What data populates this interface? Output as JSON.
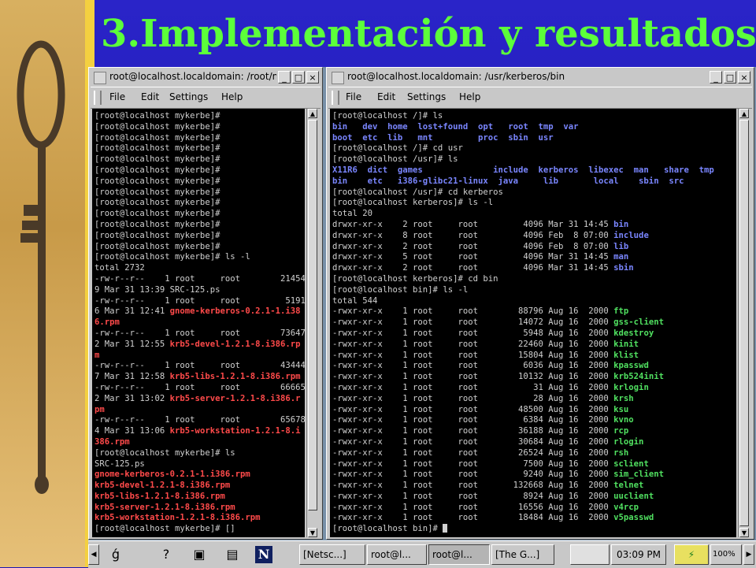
{
  "slide": {
    "title": "3.Implementación y resultados"
  },
  "colors": {
    "title": "#5cff3a",
    "slide_bg": "#1a16b4",
    "term_bg": "#000000",
    "prompt": "#d0d0d0",
    "red": "#ff4a4a",
    "blue": "#7a86ff"
  },
  "left_window": {
    "title": "root@localhost.localdomain: /root/mykerberos",
    "menu": [
      "File",
      "Edit",
      "Settings",
      "Help"
    ],
    "lines": [
      [
        {
          "t": "[root@localhost mykerbe]#"
        }
      ],
      [
        {
          "t": "[root@localhost mykerbe]#"
        }
      ],
      [
        {
          "t": "[root@localhost mykerbe]#"
        }
      ],
      [
        {
          "t": "[root@localhost mykerbe]#"
        }
      ],
      [
        {
          "t": "[root@localhost mykerbe]#"
        }
      ],
      [
        {
          "t": "[root@localhost mykerbe]#"
        }
      ],
      [
        {
          "t": "[root@localhost mykerbe]#"
        }
      ],
      [
        {
          "t": "[root@localhost mykerbe]#"
        }
      ],
      [
        {
          "t": "[root@localhost mykerbe]#"
        }
      ],
      [
        {
          "t": "[root@localhost mykerbe]#"
        }
      ],
      [
        {
          "t": "[root@localhost mykerbe]#"
        }
      ],
      [
        {
          "t": "[root@localhost mykerbe]#"
        }
      ],
      [
        {
          "t": "[root@localhost mykerbe]#"
        }
      ],
      [
        {
          "t": "[root@localhost mykerbe]# ls -l"
        }
      ],
      [
        {
          "t": "total 2732"
        }
      ],
      [
        {
          "t": "-rw-r--r--    1 root     root        21454"
        }
      ],
      [
        {
          "t": "9 Mar 31 13:39 SRC-125.ps"
        }
      ],
      [
        {
          "t": "-rw-r--r--    1 root     root         5191"
        }
      ],
      [
        {
          "t": "6 Mar 31 12:41 "
        },
        {
          "t": "gnome-kerberos-0.2.1-1.i38",
          "c": "red"
        }
      ],
      [
        {
          "t": "6.rpm",
          "c": "red"
        }
      ],
      [
        {
          "t": "-rw-r--r--    1 root     root        73647"
        }
      ],
      [
        {
          "t": "2 Mar 31 12:55 "
        },
        {
          "t": "krb5-devel-1.2.1-8.i386.rp",
          "c": "red"
        }
      ],
      [
        {
          "t": "m",
          "c": "red"
        }
      ],
      [
        {
          "t": "-rw-r--r--    1 root     root        43444"
        }
      ],
      [
        {
          "t": "7 Mar 31 12:58 "
        },
        {
          "t": "krb5-libs-1.2.1-8.i386.rpm",
          "c": "red"
        }
      ],
      [
        {
          "t": "-rw-r--r--    1 root     root        66665"
        }
      ],
      [
        {
          "t": "2 Mar 31 13:02 "
        },
        {
          "t": "krb5-server-1.2.1-8.i386.r",
          "c": "red"
        }
      ],
      [
        {
          "t": "pm",
          "c": "red"
        }
      ],
      [
        {
          "t": "-rw-r--r--    1 root     root        65678"
        }
      ],
      [
        {
          "t": "4 Mar 31 13:06 "
        },
        {
          "t": "krb5-workstation-1.2.1-8.i",
          "c": "red"
        }
      ],
      [
        {
          "t": "386.rpm",
          "c": "red"
        }
      ],
      [
        {
          "t": "[root@localhost mykerbe]# ls"
        }
      ],
      [
        {
          "t": "SRC-125.ps"
        }
      ],
      [
        {
          "t": "gnome-kerberos-0.2.1-1.i386.rpm",
          "c": "red"
        }
      ],
      [
        {
          "t": "krb5-devel-1.2.1-8.i386.rpm",
          "c": "red"
        }
      ],
      [
        {
          "t": "krb5-libs-1.2.1-8.i386.rpm",
          "c": "red"
        }
      ],
      [
        {
          "t": "krb5-server-1.2.1-8.i386.rpm",
          "c": "red"
        }
      ],
      [
        {
          "t": "krb5-workstation-1.2.1-8.i386.rpm",
          "c": "red"
        }
      ],
      [
        {
          "t": "[root@localhost mykerbe]# "
        },
        {
          "t": "[]"
        }
      ]
    ]
  },
  "right_window": {
    "title": "root@localhost.localdomain: /usr/kerberos/bin",
    "menu": [
      "File",
      "Edit",
      "Settings",
      "Help"
    ],
    "lines": [
      [
        {
          "t": "[root@localhost /]# ls"
        }
      ],
      [
        {
          "t": "bin   dev  home  lost+found  opt   root  tmp  var",
          "c": "blue"
        }
      ],
      [
        {
          "t": "boot  etc  lib   mnt         proc  sbin  usr",
          "c": "blue"
        }
      ],
      [
        {
          "t": "[root@localhost /]# cd usr"
        }
      ],
      [
        {
          "t": "[root@localhost /usr]# ls"
        }
      ],
      [
        {
          "t": "X11R6  dict  games              include  kerberos  libexec  man   share  tmp",
          "c": "blue"
        }
      ],
      [
        {
          "t": "bin    etc   i386-glibc21-linux  java     lib       local    sbin  src",
          "c": "blue"
        }
      ],
      [
        {
          "t": "[root@localhost /usr]# cd kerberos"
        }
      ],
      [
        {
          "t": "[root@localhost kerberos]# ls -l"
        }
      ],
      [
        {
          "t": "total 20"
        }
      ],
      [
        {
          "t": "drwxr-xr-x    2 root     root         4096 Mar 31 14:45 "
        },
        {
          "t": "bin",
          "c": "blue"
        }
      ],
      [
        {
          "t": "drwxr-xr-x    8 root     root         4096 Feb  8 07:00 "
        },
        {
          "t": "include",
          "c": "blue"
        }
      ],
      [
        {
          "t": "drwxr-xr-x    2 root     root         4096 Feb  8 07:00 "
        },
        {
          "t": "lib",
          "c": "blue"
        }
      ],
      [
        {
          "t": "drwxr-xr-x    5 root     root         4096 Mar 31 14:45 "
        },
        {
          "t": "man",
          "c": "blue"
        }
      ],
      [
        {
          "t": "drwxr-xr-x    2 root     root         4096 Mar 31 14:45 "
        },
        {
          "t": "sbin",
          "c": "blue"
        }
      ],
      [
        {
          "t": "[root@localhost kerberos]# cd bin"
        }
      ],
      [
        {
          "t": "[root@localhost bin]# ls -l"
        }
      ],
      [
        {
          "t": "total 544"
        }
      ],
      [
        {
          "t": "-rwxr-xr-x    1 root     root        88796 Aug 16  2000 "
        },
        {
          "t": "ftp",
          "c": "green"
        }
      ],
      [
        {
          "t": "-rwxr-xr-x    1 root     root        14072 Aug 16  2000 "
        },
        {
          "t": "gss-client",
          "c": "green"
        }
      ],
      [
        {
          "t": "-rwxr-xr-x    1 root     root         5948 Aug 16  2000 "
        },
        {
          "t": "kdestroy",
          "c": "green"
        }
      ],
      [
        {
          "t": "-rwxr-xr-x    1 root     root        22460 Aug 16  2000 "
        },
        {
          "t": "kinit",
          "c": "green"
        }
      ],
      [
        {
          "t": "-rwxr-xr-x    1 root     root        15804 Aug 16  2000 "
        },
        {
          "t": "klist",
          "c": "green"
        }
      ],
      [
        {
          "t": "-rwxr-xr-x    1 root     root         6036 Aug 16  2000 "
        },
        {
          "t": "kpasswd",
          "c": "green"
        }
      ],
      [
        {
          "t": "-rwxr-xr-x    1 root     root        10132 Aug 16  2000 "
        },
        {
          "t": "krb524init",
          "c": "green"
        }
      ],
      [
        {
          "t": "-rwxr-xr-x    1 root     root           31 Aug 16  2000 "
        },
        {
          "t": "krlogin",
          "c": "green"
        }
      ],
      [
        {
          "t": "-rwxr-xr-x    1 root     root           28 Aug 16  2000 "
        },
        {
          "t": "krsh",
          "c": "green"
        }
      ],
      [
        {
          "t": "-rwxr-xr-x    1 root     root        48500 Aug 16  2000 "
        },
        {
          "t": "ksu",
          "c": "green"
        }
      ],
      [
        {
          "t": "-rwxr-xr-x    1 root     root         6384 Aug 16  2000 "
        },
        {
          "t": "kvno",
          "c": "green"
        }
      ],
      [
        {
          "t": "-rwxr-xr-x    1 root     root        36188 Aug 16  2000 "
        },
        {
          "t": "rcp",
          "c": "green"
        }
      ],
      [
        {
          "t": "-rwxr-xr-x    1 root     root        30684 Aug 16  2000 "
        },
        {
          "t": "rlogin",
          "c": "green"
        }
      ],
      [
        {
          "t": "-rwxr-xr-x    1 root     root        26524 Aug 16  2000 "
        },
        {
          "t": "rsh",
          "c": "green"
        }
      ],
      [
        {
          "t": "-rwxr-xr-x    1 root     root         7500 Aug 16  2000 "
        },
        {
          "t": "sclient",
          "c": "green"
        }
      ],
      [
        {
          "t": "-rwxr-xr-x    1 root     root         9240 Aug 16  2000 "
        },
        {
          "t": "sim_client",
          "c": "green"
        }
      ],
      [
        {
          "t": "-rwxr-xr-x    1 root     root       132668 Aug 16  2000 "
        },
        {
          "t": "telnet",
          "c": "green"
        }
      ],
      [
        {
          "t": "-rwxr-xr-x    1 root     root         8924 Aug 16  2000 "
        },
        {
          "t": "uuclient",
          "c": "green"
        }
      ],
      [
        {
          "t": "-rwxr-xr-x    1 root     root        16556 Aug 16  2000 "
        },
        {
          "t": "v4rcp",
          "c": "green"
        }
      ],
      [
        {
          "t": "-rwxr-xr-x    1 root     root        18484 Aug 16  2000 "
        },
        {
          "t": "v5passwd",
          "c": "green"
        }
      ],
      [
        {
          "t": "[root@localhost bin]# "
        },
        {
          "cursor": true
        }
      ]
    ]
  },
  "panel": {
    "tasks": [
      "[Netsc...]",
      "root@l...",
      "root@l...",
      "[The G...]"
    ],
    "clock": "03:09 PM",
    "battery": "100%",
    "icons": [
      "gnome-foot-icon",
      "help-icon",
      "terminal-icon",
      "printer-icon",
      "netscape-icon"
    ]
  }
}
